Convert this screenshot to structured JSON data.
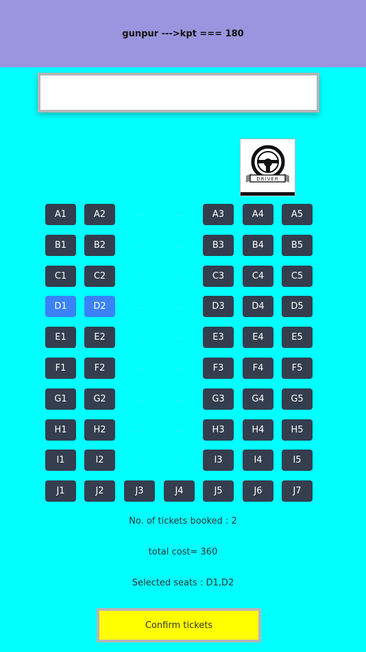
{
  "header": {
    "title": "gunpur --->kpt === 180"
  },
  "input": {
    "value": "",
    "placeholder": ""
  },
  "driver": {
    "label": "DRIVER"
  },
  "colors": {
    "background": "#00FFFF",
    "header": "#9A95DE",
    "seat": "#343E4E",
    "seat_selected": "#3B82F6",
    "confirm": "#FFFF00"
  },
  "aisle_text": "...",
  "rows": [
    {
      "seats": [
        {
          "label": "A1"
        },
        {
          "label": "A2"
        },
        {
          "label": "..."
        },
        {
          "label": "..."
        },
        {
          "label": "A3"
        },
        {
          "label": "A4"
        },
        {
          "label": "A5"
        }
      ]
    },
    {
      "seats": [
        {
          "label": "B1"
        },
        {
          "label": "B2"
        },
        {
          "label": "..."
        },
        {
          "label": "..."
        },
        {
          "label": "B3"
        },
        {
          "label": "B4"
        },
        {
          "label": "B5"
        }
      ]
    },
    {
      "seats": [
        {
          "label": "C1"
        },
        {
          "label": "C2"
        },
        {
          "label": "..."
        },
        {
          "label": "..."
        },
        {
          "label": "C3"
        },
        {
          "label": "C4"
        },
        {
          "label": "C5"
        }
      ]
    },
    {
      "seats": [
        {
          "label": "D1",
          "selected": true
        },
        {
          "label": "D2",
          "selected": true
        },
        {
          "label": "..."
        },
        {
          "label": "..."
        },
        {
          "label": "D3"
        },
        {
          "label": "D4"
        },
        {
          "label": "D5"
        }
      ]
    },
    {
      "seats": [
        {
          "label": "E1"
        },
        {
          "label": "E2"
        },
        {
          "label": "..."
        },
        {
          "label": "..."
        },
        {
          "label": "E3"
        },
        {
          "label": "E4"
        },
        {
          "label": "E5"
        }
      ]
    },
    {
      "seats": [
        {
          "label": "F1"
        },
        {
          "label": "F2"
        },
        {
          "label": "..."
        },
        {
          "label": "..."
        },
        {
          "label": "F3"
        },
        {
          "label": "F4"
        },
        {
          "label": "F5"
        }
      ]
    },
    {
      "seats": [
        {
          "label": "G1"
        },
        {
          "label": "G2"
        },
        {
          "label": "..."
        },
        {
          "label": "..."
        },
        {
          "label": "G3"
        },
        {
          "label": "G4"
        },
        {
          "label": "G5"
        }
      ]
    },
    {
      "seats": [
        {
          "label": "H1"
        },
        {
          "label": "H2"
        },
        {
          "label": "..."
        },
        {
          "label": "..."
        },
        {
          "label": "H3"
        },
        {
          "label": "H4"
        },
        {
          "label": "H5"
        }
      ]
    },
    {
      "seats": [
        {
          "label": "I1"
        },
        {
          "label": "I2"
        },
        {
          "label": "..."
        },
        {
          "label": "..."
        },
        {
          "label": "I3"
        },
        {
          "label": "I4"
        },
        {
          "label": "I5"
        }
      ]
    },
    {
      "seats": [
        {
          "label": "J1"
        },
        {
          "label": "J2"
        },
        {
          "label": "J3"
        },
        {
          "label": "J4"
        },
        {
          "label": "J5"
        },
        {
          "label": "J6"
        },
        {
          "label": "J7"
        }
      ]
    }
  ],
  "summary": {
    "tickets": "No. of tickets booked : 2",
    "cost": "total cost= 360",
    "seats": "Selected seats : D1,D2"
  },
  "confirm_label": "Confirm tickets"
}
